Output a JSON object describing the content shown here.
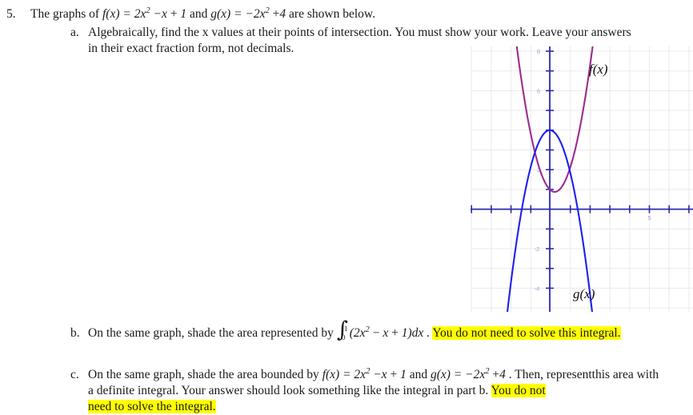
{
  "question": {
    "number": "5.",
    "stem_prefix": "The graphs of ",
    "f_def": "f(x) = 2x² −x + 1",
    "stem_mid": " and ",
    "g_def": "g(x) = −2x² +4",
    "stem_suffix": " are shown below."
  },
  "parts": [
    {
      "letter": "a.",
      "line1": "Algebraically, find the x values at their points of intersection. You must show your work. Leave your answers",
      "line2": "in their exact fraction form, not decimals."
    },
    {
      "letter": "b.",
      "line1_pre": "On the same graph, shade the area represented by ",
      "integral_lower": "0",
      "integral_upper": "1",
      "integrand": "(2x² − x + 1)dx",
      "after_integral": " . ",
      "highlight": "You do not need to solve this integral."
    },
    {
      "letter": "c.",
      "line1_pre": "On the same graph, shade the area bounded by ",
      "f_def": "f(x) = 2x² −x + 1",
      "line1_mid": "  and ",
      "g_def": "g(x) = −2x² +4",
      "line1_post": " . Then, represent",
      "line2": "this area with a definite integral. Your answer should look something like the integral in part b. ",
      "highlight_part1": "You do not",
      "line3_highlight": "need to solve the integral."
    }
  ],
  "graph": {
    "curve_labels": {
      "f": "f(x)",
      "g": "g(x)"
    },
    "colors": {
      "f_curve": "#9c2b8f",
      "g_curve": "#2020ee",
      "axis": "#2b2bab",
      "grid": "#e9e9e9",
      "tick_label": "#9aa2d8",
      "highlight": "#ffff00"
    },
    "x_tick_labels": [
      "5"
    ],
    "y_tick_labels": [
      "8",
      "6",
      "2",
      "-2",
      "-4"
    ],
    "x_axis_label": "",
    "y_axis_label": ""
  },
  "chart_data": {
    "type": "line",
    "title": "",
    "xlabel": "",
    "ylabel": "",
    "xlim": [
      -4,
      7.2
    ],
    "ylim": [
      -5.2,
      8.6
    ],
    "grid": true,
    "legend": "inline-curve-labels",
    "x_ticks": [
      -4,
      -3,
      -2,
      -1,
      0,
      1,
      2,
      3,
      4,
      5,
      6,
      7
    ],
    "y_ticks": [
      -4,
      -3,
      -2,
      -1,
      0,
      1,
      2,
      3,
      4,
      5,
      6,
      7,
      8
    ],
    "x_tick_labels_shown": {
      "5": "5"
    },
    "y_tick_labels_shown": {
      "8": "8",
      "6": "6",
      "2": "2",
      "-2": "-2",
      "-4": "-4"
    },
    "series": [
      {
        "name": "f(x)",
        "equation": "f(x) = 2x^2 - x + 1",
        "color": "#9c2b8f",
        "vertex": [
          0.25,
          0.875
        ],
        "points": [
          [
            -1.75,
            8.875
          ],
          [
            -1.5,
            7.0
          ],
          [
            -1.25,
            5.375
          ],
          [
            -1.0,
            4.0
          ],
          [
            -0.75,
            2.875
          ],
          [
            -0.5,
            2.0
          ],
          [
            -0.25,
            1.375
          ],
          [
            0.0,
            1.0
          ],
          [
            0.25,
            0.875
          ],
          [
            0.5,
            1.0
          ],
          [
            0.75,
            1.375
          ],
          [
            1.0,
            2.0
          ],
          [
            1.25,
            2.875
          ],
          [
            1.5,
            4.0
          ],
          [
            1.75,
            5.375
          ],
          [
            2.0,
            7.0
          ],
          [
            2.2,
            8.48
          ]
        ]
      },
      {
        "name": "g(x)",
        "equation": "g(x) = -2x^2 + 4",
        "color": "#2020ee",
        "vertex": [
          0.0,
          4.0
        ],
        "points": [
          [
            -2.1,
            -4.82
          ],
          [
            -2.0,
            -4.0
          ],
          [
            -1.75,
            -2.125
          ],
          [
            -1.5,
            -0.5
          ],
          [
            -1.25,
            0.875
          ],
          [
            -1.0,
            2.0
          ],
          [
            -0.75,
            2.875
          ],
          [
            -0.5,
            3.5
          ],
          [
            -0.25,
            3.875
          ],
          [
            0.0,
            4.0
          ],
          [
            0.25,
            3.875
          ],
          [
            0.5,
            3.5
          ],
          [
            0.75,
            2.875
          ],
          [
            1.0,
            2.0
          ],
          [
            1.25,
            0.875
          ],
          [
            1.5,
            -0.5
          ],
          [
            1.75,
            -2.125
          ],
          [
            2.0,
            -4.0
          ],
          [
            2.1,
            -4.82
          ]
        ]
      }
    ],
    "intersections": [
      [
        -0.6614,
        3.125
      ],
      [
        0.9114,
        2.339
      ]
    ]
  }
}
